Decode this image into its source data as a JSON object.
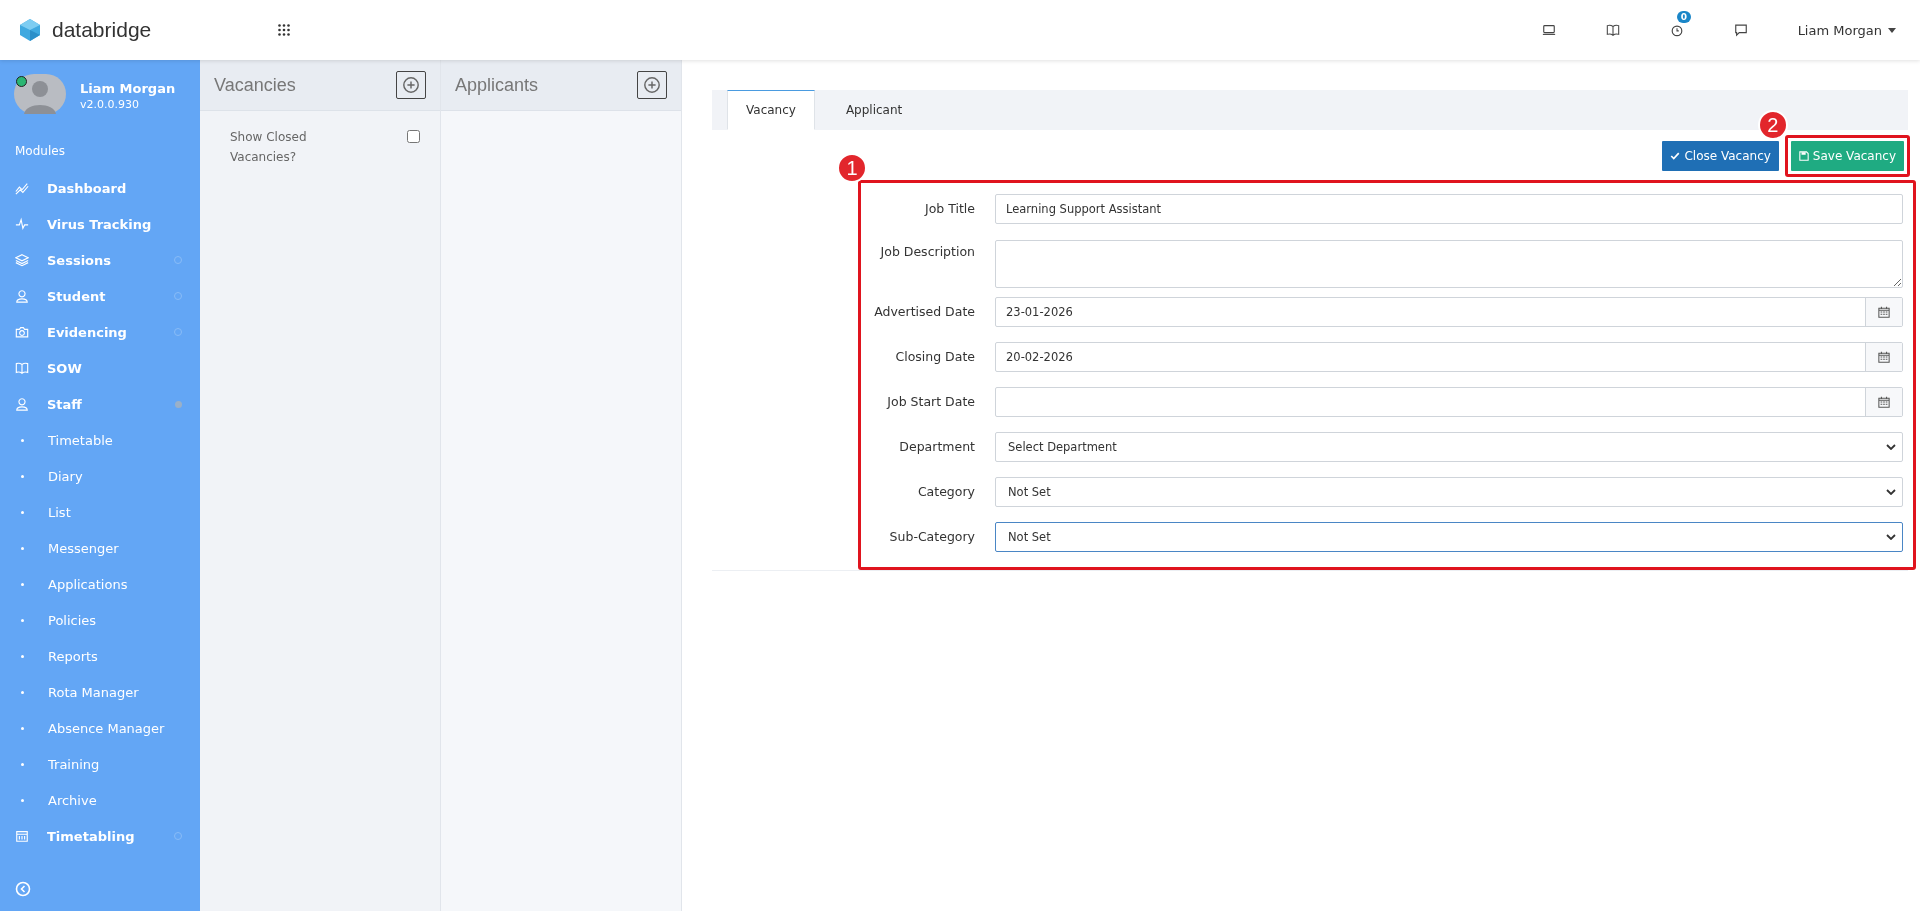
{
  "header": {
    "brand": "databridge",
    "user": "Liam Morgan",
    "notification_count": "0"
  },
  "profile": {
    "name": "Liam Morgan",
    "version": "v2.0.0.930",
    "online": true
  },
  "sidebar": {
    "heading": "Modules",
    "items": [
      {
        "label": "Dashboard",
        "kind": "module",
        "has_indicator": false
      },
      {
        "label": "Virus Tracking",
        "kind": "module",
        "has_indicator": false
      },
      {
        "label": "Sessions",
        "kind": "module",
        "has_indicator": true,
        "expanded": false
      },
      {
        "label": "Student",
        "kind": "module",
        "has_indicator": true,
        "expanded": false
      },
      {
        "label": "Evidencing",
        "kind": "module",
        "has_indicator": true,
        "expanded": false
      },
      {
        "label": "SOW",
        "kind": "module",
        "has_indicator": false
      },
      {
        "label": "Staff",
        "kind": "module",
        "has_indicator": true,
        "expanded": true
      },
      {
        "label": "Timetable",
        "kind": "sub"
      },
      {
        "label": "Diary",
        "kind": "sub"
      },
      {
        "label": "List",
        "kind": "sub"
      },
      {
        "label": "Messenger",
        "kind": "sub"
      },
      {
        "label": "Applications",
        "kind": "sub"
      },
      {
        "label": "Policies",
        "kind": "sub"
      },
      {
        "label": "Reports",
        "kind": "sub"
      },
      {
        "label": "Rota Manager",
        "kind": "sub"
      },
      {
        "label": "Absence Manager",
        "kind": "sub"
      },
      {
        "label": "Training",
        "kind": "sub"
      },
      {
        "label": "Archive",
        "kind": "sub"
      },
      {
        "label": "Timetabling",
        "kind": "module",
        "has_indicator": true,
        "expanded": false
      }
    ]
  },
  "vacancies_panel": {
    "title": "Vacancies",
    "show_closed_label": "Show Closed Vacancies?",
    "show_closed_checked": false
  },
  "applicants_panel": {
    "title": "Applicants"
  },
  "tabs": [
    {
      "label": "Vacancy",
      "selected": true
    },
    {
      "label": "Applicant",
      "selected": false
    }
  ],
  "buttons": {
    "close": "Close Vacancy",
    "save": "Save Vacancy"
  },
  "annotations": [
    {
      "label": "1"
    },
    {
      "label": "2"
    }
  ],
  "form": [
    {
      "label": "Job Title",
      "kind": "text",
      "value": "Learning Support Assistant",
      "focused": false
    },
    {
      "label": "Job Description",
      "kind": "textarea",
      "focused": false
    },
    {
      "label": "Advertised Date",
      "kind": "date",
      "value": "23-01-2026",
      "focused": false
    },
    {
      "label": "Closing Date",
      "kind": "date",
      "value": "20-02-2026",
      "focused": false
    },
    {
      "label": "Job Start Date",
      "kind": "date",
      "focused": false
    },
    {
      "label": "Department",
      "kind": "select",
      "value": "Select Department",
      "focused": false
    },
    {
      "label": "Category",
      "kind": "select",
      "value": "Not Set",
      "focused": false
    },
    {
      "label": "Sub-Category",
      "kind": "select",
      "value": "Not Set",
      "focused": true
    }
  ]
}
